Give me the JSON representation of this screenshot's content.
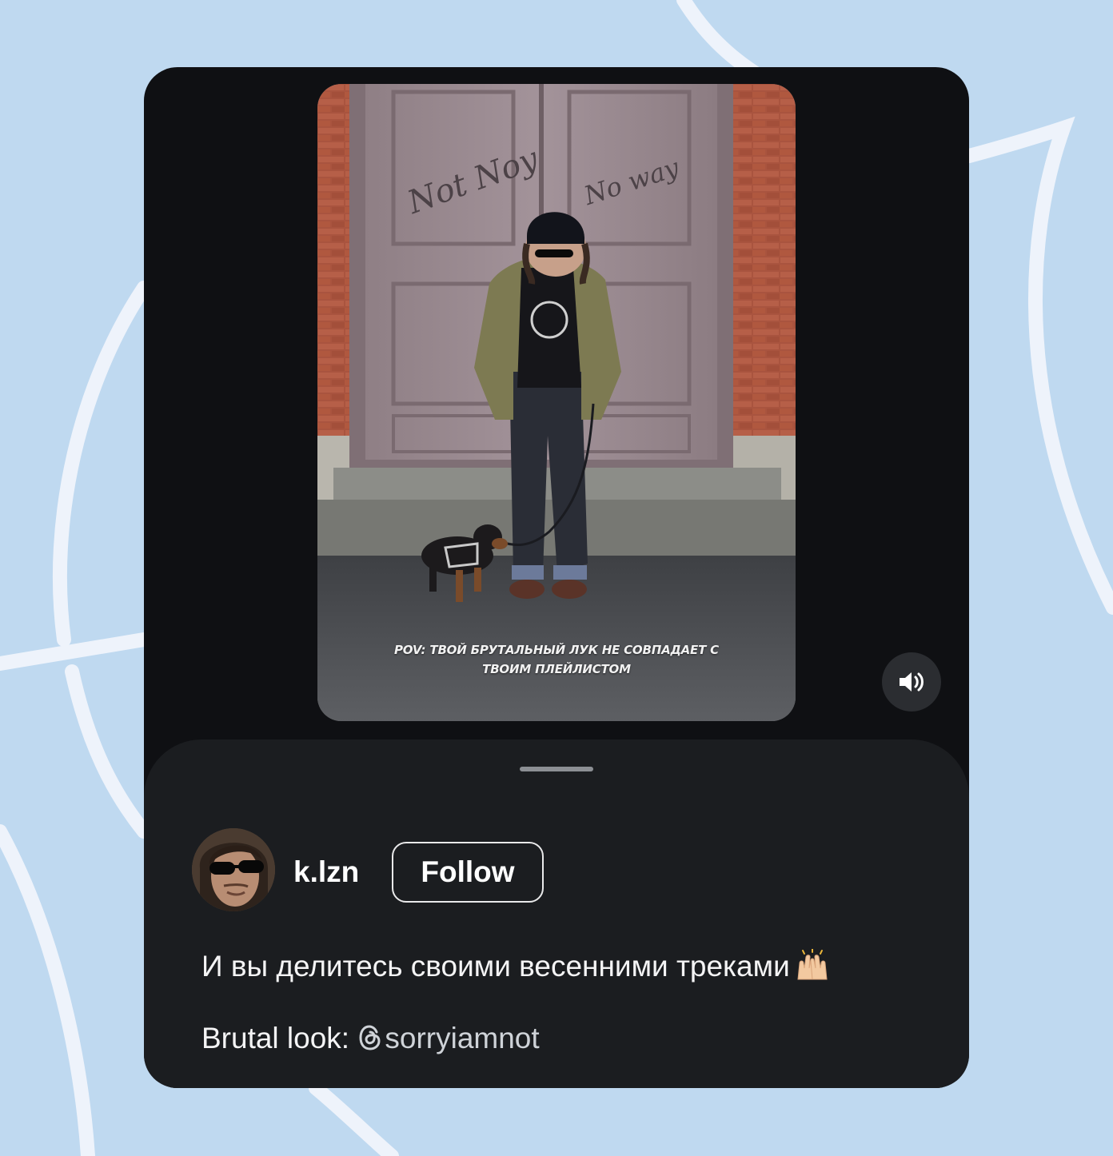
{
  "video": {
    "caption_prefix": "POV:",
    "caption_line1": "ТВОЙ БРУТАЛЬНЫЙ ЛУК НЕ СОВПАДАЕТ С",
    "caption_line2": "ТВОИМ ПЛЕЙЛИСТОМ",
    "graffiti_left": "Not Noy",
    "graffiti_right": "No way"
  },
  "sound_button": {
    "icon": "speaker-icon",
    "state": "unmuted"
  },
  "post": {
    "username": "k.lzn",
    "follow_label": "Follow",
    "text": "И вы делитесь своими весенними треками",
    "emoji": "raising-hands-emoji",
    "link_label": "Brutal look:",
    "mention": "sorryiamnot"
  },
  "colors": {
    "page_background": "#bfd9f0",
    "card_background": "#0f1013",
    "sheet_background": "#1b1d20",
    "text": "#f4f4f5"
  }
}
